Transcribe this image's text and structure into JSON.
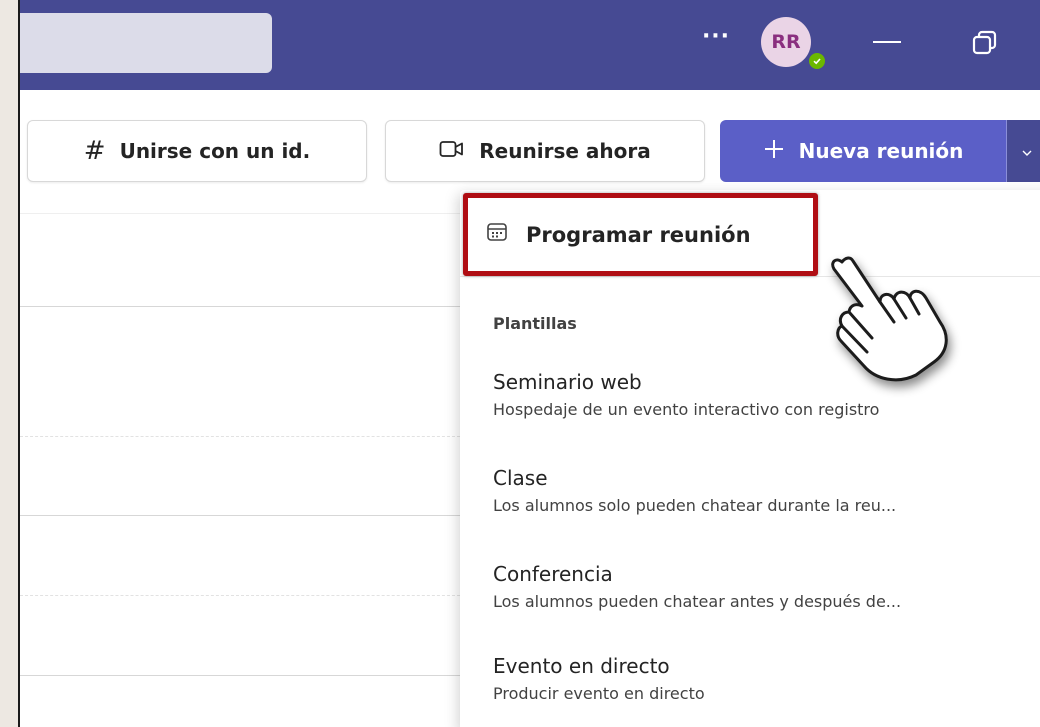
{
  "titlebar": {
    "more_label": "···",
    "avatar_initials": "RR",
    "presence_status": "available"
  },
  "toolbar": {
    "join_icon": "#",
    "join_label": "Unirse con un id.",
    "meet_now_label": "Reunirse ahora",
    "new_meeting_label": "Nueva reunión"
  },
  "menu": {
    "schedule_label": "Programar reunión",
    "templates_heading": "Plantillas",
    "templates": [
      {
        "title": "Seminario web",
        "description": "Hospedaje de un evento interactivo con registro"
      },
      {
        "title": "Clase",
        "description": "Los alumnos solo pueden chatear durante la reu..."
      },
      {
        "title": "Conferencia",
        "description": "Los alumnos pueden chatear antes y después de..."
      },
      {
        "title": "Evento en directo",
        "description": "Producir evento en directo"
      }
    ]
  },
  "colors": {
    "titlebar": "#464a93",
    "primary_button": "#5b5fc7",
    "highlight_border": "#b00e14",
    "presence": "#6bb700"
  },
  "icons": [
    "hash-icon",
    "video-camera-icon",
    "plus-icon",
    "chevron-down-icon",
    "calendar-icon",
    "minimize-icon",
    "restore-icon",
    "pointing-hand-cursor-icon"
  ]
}
